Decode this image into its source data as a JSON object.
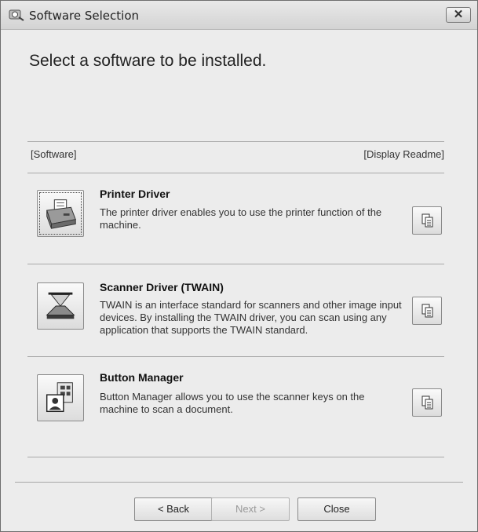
{
  "window": {
    "title": "Software Selection",
    "close_label": "✕"
  },
  "main": {
    "heading": "Select a software to be installed.",
    "software_column_label": "[Software]",
    "readme_column_label": "[Display Readme]"
  },
  "items": [
    {
      "title": "Printer Driver",
      "description": "The printer driver enables you to use the printer function of the machine.",
      "icon": "printer-icon"
    },
    {
      "title": "Scanner Driver (TWAIN)",
      "description": "TWAIN is an interface standard for scanners and other image input devices. By installing the TWAIN driver, you can scan using any application that supports the TWAIN standard.",
      "icon": "scanner-icon"
    },
    {
      "title": "Button Manager",
      "description": "Button Manager allows you to use the scanner keys on the machine to scan a document.",
      "icon": "button-manager-icon"
    }
  ],
  "footer": {
    "back_label": "< Back",
    "next_label": "Next >",
    "close_label": "Close"
  }
}
